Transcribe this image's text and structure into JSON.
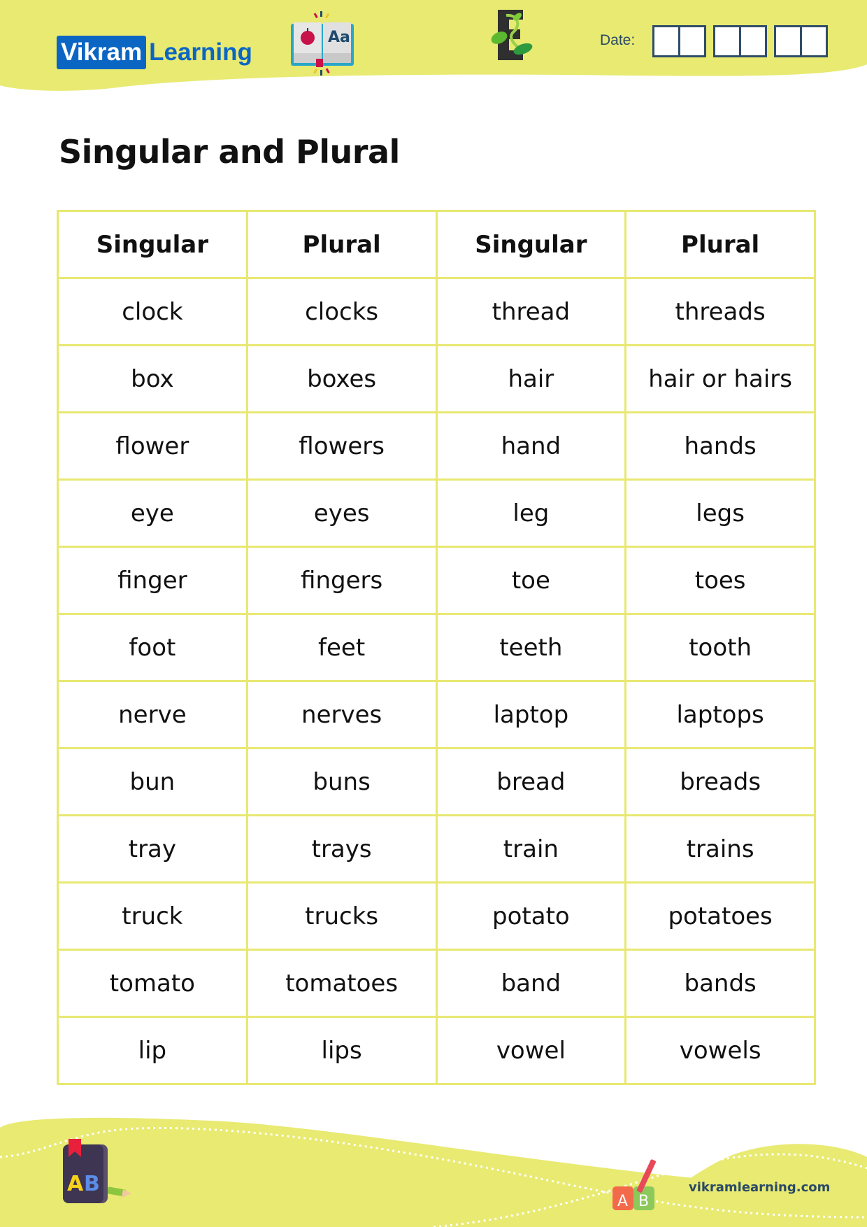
{
  "header": {
    "logo_part1": "Vikram",
    "logo_part2": "Learning",
    "date_label": "Date:",
    "date_groups": 3,
    "icons": [
      "open-book-apple-icon",
      "leafy-letter-e-icon"
    ]
  },
  "title": "Singular and Plural",
  "table": {
    "headers": [
      "Singular",
      "Plural",
      "Singular",
      "Plural"
    ],
    "rows": [
      [
        "clock",
        "clocks",
        "thread",
        "threads"
      ],
      [
        "box",
        "boxes",
        "hair",
        "hair or hairs"
      ],
      [
        "flower",
        "flowers",
        "hand",
        "hands"
      ],
      [
        "eye",
        "eyes",
        "leg",
        "legs"
      ],
      [
        "finger",
        "fingers",
        "toe",
        "toes"
      ],
      [
        "foot",
        "feet",
        "teeth",
        "tooth"
      ],
      [
        "nerve",
        "nerves",
        "laptop",
        "laptops"
      ],
      [
        "bun",
        "buns",
        "bread",
        "breads"
      ],
      [
        "tray",
        "trays",
        "train",
        "trains"
      ],
      [
        "truck",
        "trucks",
        "potato",
        "potatoes"
      ],
      [
        "tomato",
        "tomatoes",
        "band",
        "bands"
      ],
      [
        "lip",
        "lips",
        "vowel",
        "vowels"
      ]
    ]
  },
  "footer": {
    "website": "vikramlearning.com",
    "icons": [
      "ab-book-pencil-icon",
      "ab-blocks-pencil-icon"
    ]
  },
  "colors": {
    "accent_yellow": "#e8ea72",
    "brand_blue": "#0b66c3",
    "navy": "#2f4d69"
  }
}
